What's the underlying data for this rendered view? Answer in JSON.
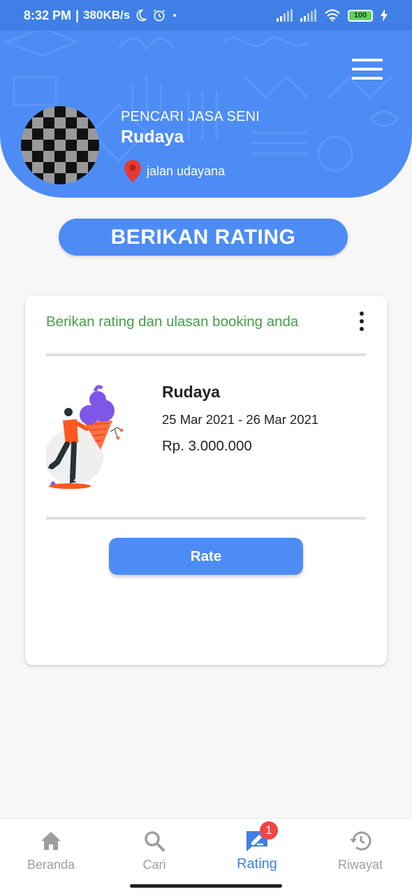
{
  "status_bar": {
    "time": "8:32 PM",
    "separator": "|",
    "speed": "380KB/s",
    "battery": "100",
    "icons": [
      "moon-icon",
      "alarm-icon",
      "signal-icon",
      "wifi-icon",
      "battery-icon",
      "charging-icon"
    ]
  },
  "header": {
    "role": "PENCARI JASA SENI",
    "name": "Rudaya",
    "location": "jalan udayana",
    "accent_color": "#4d8cf5"
  },
  "page_title": "BERIKAN RATING",
  "card": {
    "heading": "Berikan rating dan ulasan booking anda",
    "heading_color": "#43a047",
    "booking": {
      "name": "Rudaya",
      "dates": "25 Mar 2021 - 26 Mar 2021",
      "price": "Rp. 3.000.000"
    },
    "rate_label": "Rate"
  },
  "bottom_nav": {
    "items": [
      {
        "label": "Beranda",
        "icon": "home-icon",
        "active": false
      },
      {
        "label": "Cari",
        "icon": "search-icon",
        "active": false
      },
      {
        "label": "Rating",
        "icon": "rate-review-icon",
        "active": true,
        "badge": "1"
      },
      {
        "label": "Riwayat",
        "icon": "history-icon",
        "active": false
      }
    ]
  }
}
